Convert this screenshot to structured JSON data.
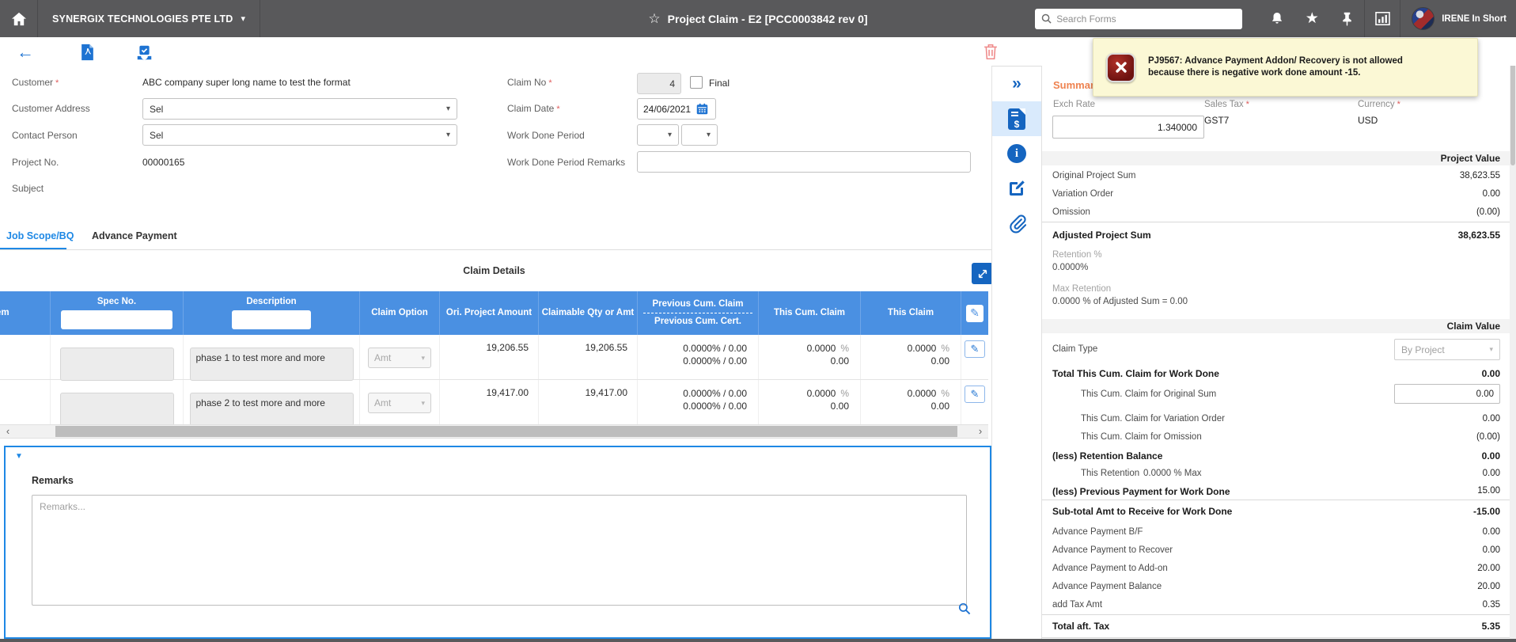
{
  "glyphs": {
    "required": "*",
    "caret": "▾",
    "back_arrow": "←",
    "chevron_left": "‹",
    "chevron_right": "›",
    "collapse_triangle": "▼",
    "double_chevron": "»",
    "star_outline": "☆",
    "star_filled": "★",
    "pencil": "✎",
    "info": "i"
  },
  "topbar": {
    "company": "SYNERGIX TECHNOLOGIES PTE LTD",
    "title": "Project Claim - E2 [PCC0003842 rev 0]",
    "search_placeholder": "Search Forms",
    "user": "IRENE In Short"
  },
  "error_popup": {
    "message": "PJ9567: Advance Payment Addon/ Recovery is not allowed because there is negative work done amount -15."
  },
  "form": {
    "customer": {
      "label": "Customer",
      "value": "ABC company super long name to test the format"
    },
    "customer_address": {
      "label": "Customer Address",
      "value": "Sel"
    },
    "contact_person": {
      "label": "Contact Person",
      "value": "Sel"
    },
    "project_no": {
      "label": "Project No.",
      "value": "00000165"
    },
    "subject": {
      "label": "Subject",
      "value": ""
    },
    "claim_no": {
      "label": "Claim No",
      "value": "4",
      "final_label": "Final"
    },
    "claim_date": {
      "label": "Claim Date",
      "value": "24/06/2021"
    },
    "work_done_period": {
      "label": "Work Done Period"
    },
    "work_done_period_remarks": {
      "label": "Work Done Period Remarks",
      "value": ""
    }
  },
  "tabs": {
    "job_scope": "Job Scope/BQ",
    "advance_payment": "Advance Payment"
  },
  "claim_details": {
    "title": "Claim Details",
    "columns": {
      "item": "Item",
      "spec_no": "Spec No.",
      "description": "Description",
      "claim_option": "Claim Option",
      "ori_project_amount": "Ori. Project Amount",
      "claimable": "Claimable Qty or Amt",
      "previous_cum_claim": "Previous Cum. Claim",
      "previous_cum_cert": "Previous Cum. Cert.",
      "this_cum_claim": "This Cum. Claim",
      "this_claim": "This Claim"
    },
    "rows": [
      {
        "spec_no": "",
        "description": "phase 1 to test more and more",
        "claim_option": "Amt",
        "ori_project_amount": "19,206.55",
        "claimable": "19,206.55",
        "previous_cum_claim": "0.0000% / 0.00",
        "previous_cum_cert": "0.0000% / 0.00",
        "this_cum_claim_pct": "0.0000",
        "this_cum_claim_pct_sign": "%",
        "this_cum_claim_amt": "0.00",
        "this_claim_pct": "0.0000",
        "this_claim_pct_sign": "%",
        "this_claim_amt": "0.00"
      },
      {
        "spec_no": "",
        "description": "phase 2 to test more and more",
        "claim_option": "Amt",
        "ori_project_amount": "19,417.00",
        "claimable": "19,417.00",
        "previous_cum_claim": "0.0000% / 0.00",
        "previous_cum_cert": "0.0000% / 0.00",
        "this_cum_claim_pct": "0.0000",
        "this_cum_claim_pct_sign": "%",
        "this_cum_claim_amt": "0.00",
        "this_claim_pct": "0.0000",
        "this_claim_pct_sign": "%",
        "this_claim_amt": "0.00"
      }
    ]
  },
  "remarks": {
    "label": "Remarks",
    "placeholder": "Remarks..."
  },
  "summary": {
    "title": "Summary",
    "exch_rate": {
      "label": "Exch Rate",
      "value": "1.340000"
    },
    "sales_tax": {
      "label": "Sales Tax",
      "value": "GST7"
    },
    "currency": {
      "label": "Currency",
      "value": "USD"
    },
    "project_value": {
      "section": "Project Value",
      "original_project_sum": {
        "label": "Original Project Sum",
        "value": "38,623.55"
      },
      "variation_order": {
        "label": "Variation Order",
        "value": "0.00"
      },
      "omission": {
        "label": "Omission",
        "value": "(0.00)"
      },
      "adjusted_project_sum": {
        "label": "Adjusted Project Sum",
        "value": "38,623.55"
      },
      "retention_pct": {
        "label": "Retention %",
        "value": "0.0000%"
      },
      "max_retention": {
        "label": "Max Retention",
        "value": "0.0000 % of Adjusted Sum = 0.00"
      }
    },
    "claim_value": {
      "section": "Claim Value",
      "claim_type": {
        "label": "Claim Type",
        "value": "By Project"
      },
      "total_this_cum": {
        "label": "Total This Cum. Claim for Work Done",
        "value": "0.00"
      },
      "this_cum_original": {
        "label": "This Cum. Claim for Original Sum",
        "value": "0.00"
      },
      "this_cum_variation": {
        "label": "This Cum. Claim for Variation Order",
        "value": "0.00"
      },
      "this_cum_omission": {
        "label": "This Cum. Claim for Omission",
        "value": "(0.00)"
      },
      "less_retention_balance": {
        "label": "(less) Retention Balance",
        "value": "0.00"
      },
      "this_retention": {
        "label": "This Retention",
        "mid": "0.0000  % Max",
        "value": "0.00"
      },
      "less_previous_payment": {
        "label": "(less) Previous Payment for Work Done",
        "value": "15.00"
      },
      "subtotal_work_done": {
        "label": "Sub-total Amt to Receive for Work Done",
        "value": "-15.00"
      },
      "advance_bf": {
        "label": "Advance Payment B/F",
        "value": "0.00"
      },
      "advance_recover": {
        "label": "Advance Payment to Recover",
        "value": "0.00"
      },
      "advance_addon": {
        "label": "Advance Payment to Add-on",
        "value": "20.00"
      },
      "advance_balance": {
        "label": "Advance Payment Balance",
        "value": "20.00"
      },
      "add_tax_amt": {
        "label": "add Tax Amt",
        "value": "0.35"
      },
      "total_aft_tax": {
        "label": "Total aft. Tax",
        "value": "5.35"
      }
    }
  }
}
